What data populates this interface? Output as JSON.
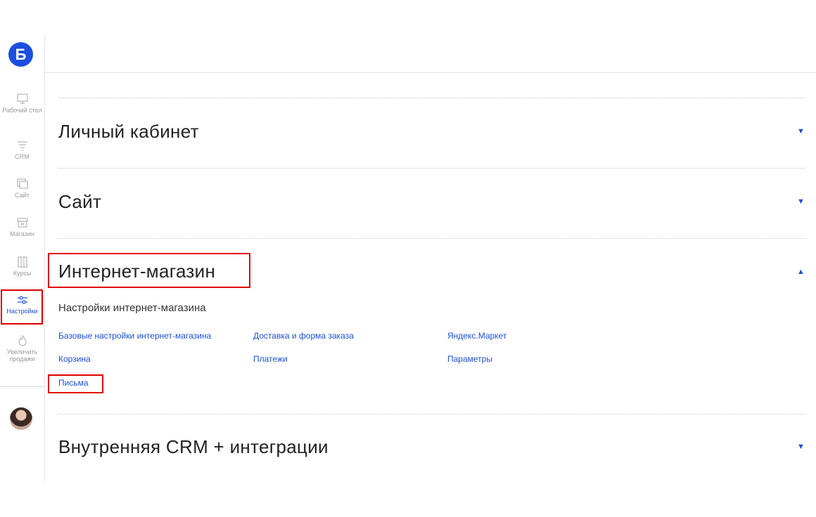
{
  "sidebar": {
    "logo": "Б",
    "items": [
      {
        "label": "Рабочий стол",
        "icon": "monitor-icon"
      },
      {
        "label": "CRM",
        "icon": "funnel-icon"
      },
      {
        "label": "Сайт",
        "icon": "pages-icon"
      },
      {
        "label": "Магазин",
        "icon": "store-icon"
      },
      {
        "label": "Курсы",
        "icon": "books-icon"
      },
      {
        "label": "Настройки",
        "icon": "sliders-icon"
      },
      {
        "label": "Увеличить продажи",
        "icon": "fire-icon"
      }
    ]
  },
  "sections": [
    {
      "title": "Личный кабинет",
      "state": "collapsed",
      "arrow": "▼"
    },
    {
      "title": "Сайт",
      "state": "collapsed",
      "arrow": "▼"
    },
    {
      "title": "Интернет-магазин",
      "state": "expanded",
      "arrow": "▲"
    },
    {
      "title": "Внутренняя CRM + интеграции",
      "state": "collapsed",
      "arrow": "▼"
    }
  ],
  "shop_settings": {
    "heading": "Настройки интернет-магазина",
    "links": [
      "Базовые настройки интернет-магазина",
      "Доставка и форма заказа",
      "Яндекс.Маркет",
      "Корзина",
      "Платежи",
      "Параметры",
      "Письма"
    ]
  },
  "colors": {
    "accent": "#1c4fe0",
    "highlight": "#e00000"
  }
}
